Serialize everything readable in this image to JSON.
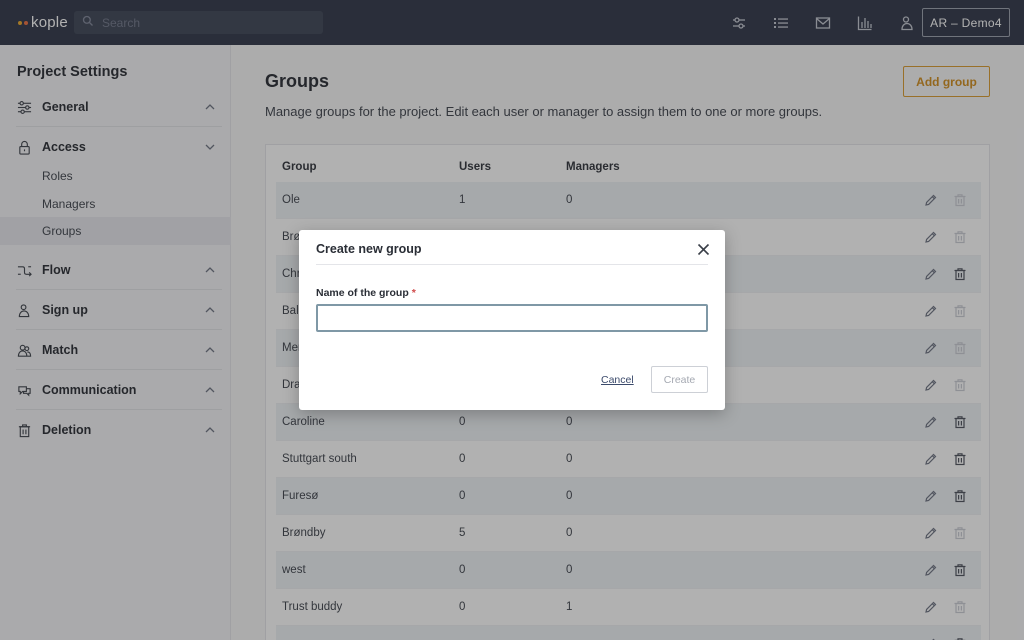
{
  "topbar": {
    "logo_text": "kople",
    "logo_dot_colors": [
      "#e8a628",
      "#ec6c3c"
    ],
    "search_placeholder": "Search",
    "icons": [
      "sliders-icon",
      "list-icon",
      "mail-icon",
      "chart-icon",
      "person-icon"
    ],
    "user_label": "AR – Demo4"
  },
  "sidebar": {
    "title": "Project Settings",
    "sections": [
      {
        "label": "General",
        "icon": "sliders-icon",
        "expanded": false
      },
      {
        "label": "Access",
        "icon": "lock-icon",
        "expanded": true,
        "items": [
          "Roles",
          "Managers",
          "Groups"
        ],
        "active_item": "Groups"
      },
      {
        "label": "Flow",
        "icon": "flow-icon",
        "expanded": false
      },
      {
        "label": "Sign up",
        "icon": "signup-icon",
        "expanded": false
      },
      {
        "label": "Match",
        "icon": "match-icon",
        "expanded": false
      },
      {
        "label": "Communication",
        "icon": "chat-icon",
        "expanded": false
      },
      {
        "label": "Deletion",
        "icon": "trash-icon",
        "expanded": false
      }
    ]
  },
  "main": {
    "title": "Groups",
    "description": "Manage groups for the project. Edit each user or manager to assign them to one or more groups.",
    "add_button": "Add group",
    "table": {
      "headers": [
        "Group",
        "Users",
        "Managers"
      ],
      "rows": [
        {
          "group": "Ole",
          "users": "1",
          "managers": "0",
          "delete_enabled": false
        },
        {
          "group": "Brø",
          "users": "",
          "managers": "",
          "delete_enabled": false
        },
        {
          "group": "Chr",
          "users": "",
          "managers": "",
          "delete_enabled": true
        },
        {
          "group": "Bal",
          "users": "",
          "managers": "",
          "delete_enabled": false
        },
        {
          "group": "Mer",
          "users": "",
          "managers": "",
          "delete_enabled": false
        },
        {
          "group": "Dra",
          "users": "",
          "managers": "",
          "delete_enabled": false
        },
        {
          "group": "Caroline",
          "users": "0",
          "managers": "0",
          "delete_enabled": true
        },
        {
          "group": "Stuttgart south",
          "users": "0",
          "managers": "0",
          "delete_enabled": true
        },
        {
          "group": "Furesø",
          "users": "0",
          "managers": "0",
          "delete_enabled": true
        },
        {
          "group": "Brøndby",
          "users": "5",
          "managers": "0",
          "delete_enabled": false
        },
        {
          "group": "west",
          "users": "0",
          "managers": "0",
          "delete_enabled": true
        },
        {
          "group": "Trust buddy",
          "users": "0",
          "managers": "1",
          "delete_enabled": false
        },
        {
          "group": "",
          "users": "",
          "managers": "",
          "delete_enabled": true
        }
      ]
    }
  },
  "modal": {
    "title": "Create new group",
    "field_label": "Name of the group",
    "required_mark": "*",
    "field_value": "",
    "cancel_label": "Cancel",
    "create_label": "Create"
  }
}
